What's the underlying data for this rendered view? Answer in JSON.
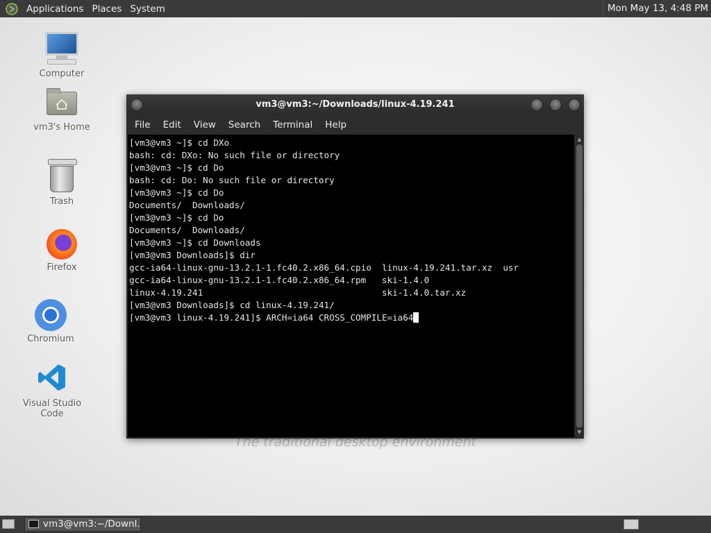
{
  "top_panel": {
    "menus": [
      "Applications",
      "Places",
      "System"
    ],
    "clock": "Mon May 13,  4:48 PM"
  },
  "desktop": {
    "tagline": "The traditional desktop environment",
    "icons": [
      {
        "label": "Computer",
        "icon": "computer-icon"
      },
      {
        "label": "vm3's Home",
        "icon": "home-folder-icon"
      },
      {
        "label": "Trash",
        "icon": "trash-icon"
      },
      {
        "label": "Firefox",
        "icon": "firefox-icon"
      },
      {
        "label": "Chromium",
        "icon": "chromium-icon"
      },
      {
        "label": "Visual Studio Code",
        "icon": "vscode-icon"
      }
    ]
  },
  "terminal": {
    "title": "vm3@vm3:~/Downloads/linux-4.19.241",
    "menu": [
      "File",
      "Edit",
      "View",
      "Search",
      "Terminal",
      "Help"
    ],
    "lines": [
      "[vm3@vm3 ~]$ cd DXo",
      "bash: cd: DXo: No such file or directory",
      "[vm3@vm3 ~]$ cd Do",
      "bash: cd: Do: No such file or directory",
      "[vm3@vm3 ~]$ cd Do",
      "Documents/  Downloads/",
      "[vm3@vm3 ~]$ cd Do",
      "Documents/  Downloads/",
      "[vm3@vm3 ~]$ cd Downloads",
      "[vm3@vm3 Downloads]$ dir",
      "gcc-ia64-linux-gnu-13.2.1-1.fc40.2.x86_64.cpio  linux-4.19.241.tar.xz  usr",
      "gcc-ia64-linux-gnu-13.2.1-1.fc40.2.x86_64.rpm   ski-1.4.0",
      "linux-4.19.241                                  ski-1.4.0.tar.xz",
      "[vm3@vm3 Downloads]$ cd linux-4.19.241/",
      "[vm3@vm3 linux-4.19.241]$ ARCH=ia64 CROSS_COMPILE=ia64"
    ]
  },
  "bottom_panel": {
    "task_label": "vm3@vm3:~/Downl..."
  }
}
